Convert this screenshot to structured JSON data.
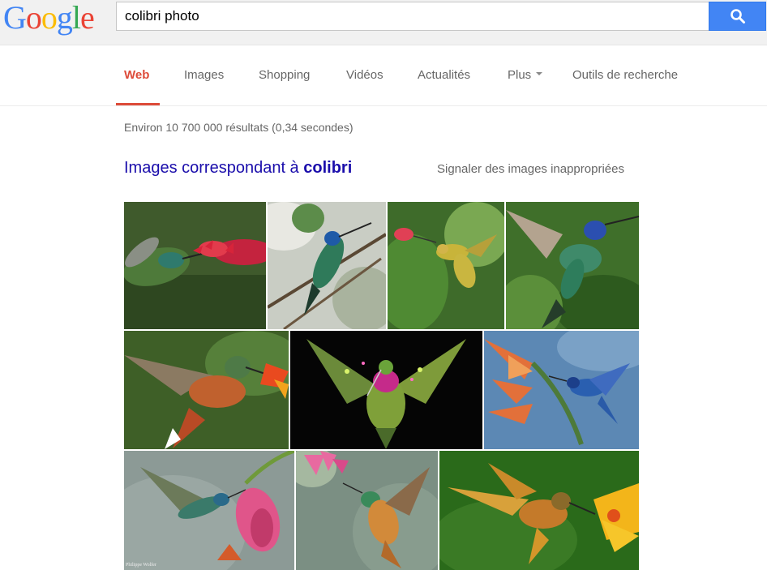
{
  "search": {
    "query": "colibri photo",
    "logo_letters": [
      {
        "char": "G",
        "color": "#4285f4"
      },
      {
        "char": "o",
        "color": "#ea4335"
      },
      {
        "char": "o",
        "color": "#fbbc05"
      },
      {
        "char": "g",
        "color": "#4285f4"
      },
      {
        "char": "l",
        "color": "#34a853"
      },
      {
        "char": "e",
        "color": "#ea4335"
      }
    ],
    "button_icon": "search-icon",
    "button_color": "#4285f4"
  },
  "nav": {
    "tabs": [
      {
        "label": "Web"
      },
      {
        "label": "Images"
      },
      {
        "label": "Shopping"
      },
      {
        "label": "Vidéos"
      },
      {
        "label": "Actualités"
      },
      {
        "label": "Plus"
      },
      {
        "label": "Outils de recherche"
      }
    ],
    "active_color": "#dd4b39"
  },
  "results": {
    "stats": "Environ 10 700 000 résultats (0,34 secondes)",
    "images_heading_prefix": "Images correspondant à ",
    "images_heading_term": "colibri",
    "report_link": "Signaler des images inappropriées",
    "thumbnails": [
      {
        "alt": "hummingbird-red-flower"
      },
      {
        "alt": "hummingbird-on-branch"
      },
      {
        "alt": "hummingbird-yellow-hovering"
      },
      {
        "alt": "hummingbird-green-blue"
      },
      {
        "alt": "hummingbird-rufous-flower"
      },
      {
        "alt": "hummingbird-glowing-dark"
      },
      {
        "alt": "hummingbird-blue-orange-flowers"
      },
      {
        "alt": "hummingbird-pink-hibiscus"
      },
      {
        "alt": "hummingbird-pink-flowers"
      },
      {
        "alt": "hummingbird-golden-yellow-flower"
      }
    ],
    "watermark": "Philippe Wolfer"
  }
}
